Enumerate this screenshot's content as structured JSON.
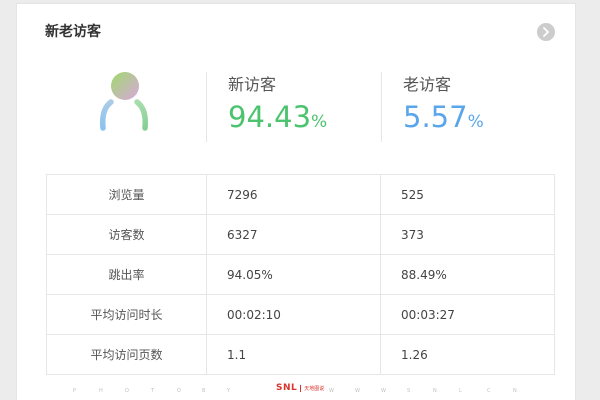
{
  "panel": {
    "title": "新老访客",
    "more_icon": "chevron-right-icon"
  },
  "summary": {
    "icon": "user-icon",
    "new_visitor": {
      "label": "新访客",
      "value": "94.43",
      "unit": "%",
      "color": "#4cc36f"
    },
    "old_visitor": {
      "label": "老访客",
      "value": "5.57",
      "unit": "%",
      "color": "#5aa6ea"
    }
  },
  "table": {
    "rows": [
      {
        "name": "浏览量",
        "new": "7296",
        "old": "525"
      },
      {
        "name": "访客数",
        "new": "6327",
        "old": "373"
      },
      {
        "name": "跳出率",
        "new": "94.05%",
        "old": "88.49%"
      },
      {
        "name": "平均访问时长",
        "new": "00:02:10",
        "old": "00:03:27"
      },
      {
        "name": "平均访问页数",
        "new": "1.1",
        "old": "1.26"
      }
    ]
  },
  "watermark": {
    "letters": [
      "P",
      "H",
      "O",
      "T",
      "O",
      "B",
      "Y",
      "W",
      "W",
      "W",
      "S",
      "N",
      "L",
      "C",
      "N"
    ],
    "logo_text": "SNL",
    "logo_subtext": "天地图说"
  }
}
